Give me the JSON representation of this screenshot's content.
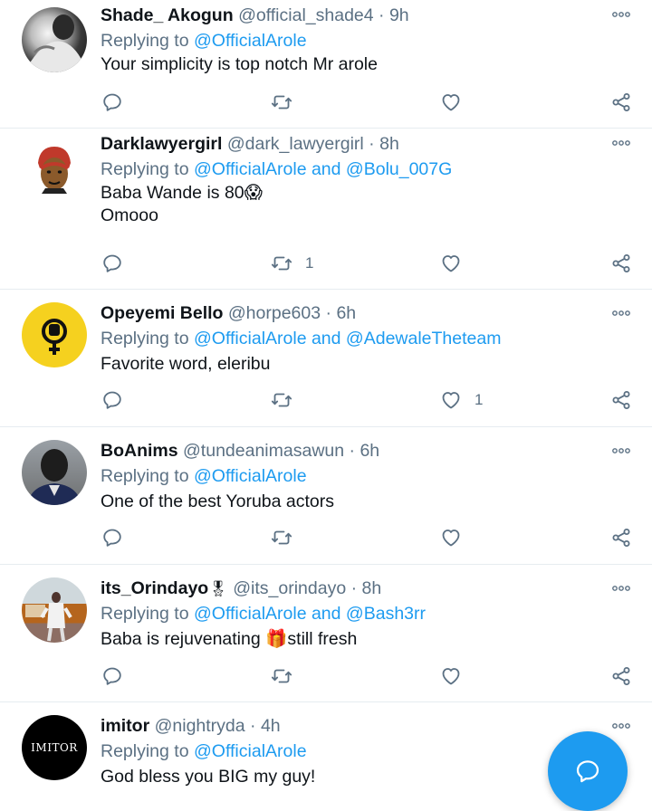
{
  "tweets": [
    {
      "name": "Shade_ Akogun",
      "handle": "@official_shade4",
      "time": "9h",
      "reply_prefix": "Replying to ",
      "mentions": [
        "@OfficialArole"
      ],
      "text": "Your simplicity is top notch Mr arole",
      "retweets": "",
      "likes": ""
    },
    {
      "name": "Darklawyergirl",
      "handle": "@dark_lawyergirl",
      "time": "8h",
      "reply_prefix": "Replying to ",
      "mentions": [
        "@OfficialArole",
        "@Bolu_007G"
      ],
      "and": " and ",
      "text_line1": "Baba Wande is 80😱",
      "text_line2": "Omooo",
      "retweets": "1",
      "likes": ""
    },
    {
      "name": "Opeyemi Bello",
      "handle": "@horpe603",
      "time": "6h",
      "reply_prefix": "Replying to ",
      "mentions": [
        "@OfficialArole",
        "@AdewaleTheteam"
      ],
      "and": " and ",
      "text": "Favorite word, eleribu",
      "retweets": "",
      "likes": "1"
    },
    {
      "name": "BoAnims",
      "handle": "@tundeanimasawun",
      "time": "6h",
      "reply_prefix": "Replying to ",
      "mentions": [
        "@OfficialArole"
      ],
      "text": "One of the best Yoruba actors",
      "retweets": "",
      "likes": ""
    },
    {
      "name": "its_Orindayo",
      "name_badge": "🎖",
      "handle": "@its_orindayo",
      "time": "8h",
      "reply_prefix": "Replying to ",
      "mentions": [
        "@OfficialArole",
        "@Bash3rr"
      ],
      "and": " and ",
      "text": "Baba is rejuvenating 🎁still fresh",
      "retweets": "",
      "likes": ""
    },
    {
      "name": "imitor",
      "handle": "@nightryda",
      "time": "4h",
      "reply_prefix": "Replying to ",
      "mentions": [
        "@OfficialArole"
      ],
      "text": "God bless you BIG my guy!",
      "avatar_text": "IMITOR"
    }
  ],
  "separator": " · ",
  "icons": {
    "more": "more-dots-icon",
    "reply": "reply-bubble-icon",
    "retweet": "retweet-icon",
    "like": "heart-icon",
    "share": "share-icon",
    "fab": "compose-reply-icon"
  },
  "colors": {
    "accent": "#1d9bf0",
    "muted": "#5b7083",
    "text": "#0f1419",
    "divider": "#e6ecf0"
  }
}
